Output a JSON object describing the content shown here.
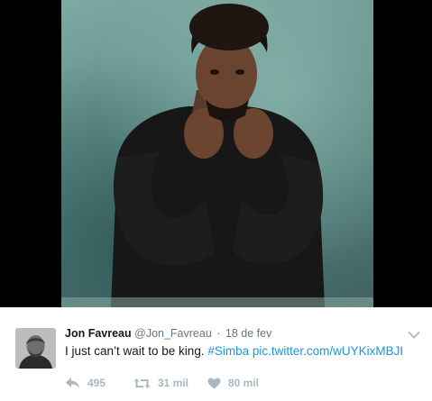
{
  "tweet": {
    "display_name": "Jon Favreau",
    "handle": "@Jon_Favreau",
    "separator": "·",
    "timestamp": "18 de fev",
    "text": "I just can’t wait to be king.",
    "hashtag": "#Simba",
    "pic_link": "pic.twitter.com/wUYKixMBJI"
  },
  "actions": {
    "reply": {
      "icon": "reply-icon",
      "count": "495"
    },
    "retweet": {
      "icon": "retweet-icon",
      "count": "31 mil"
    },
    "like": {
      "icon": "heart-icon",
      "count": "80 mil"
    }
  },
  "colors": {
    "link": "#1b95e0",
    "name": "#14171a",
    "secondary": "#657786",
    "action": "#aab8c2",
    "media_background": "#000000",
    "photo_backdrop": "#5f8d88"
  }
}
